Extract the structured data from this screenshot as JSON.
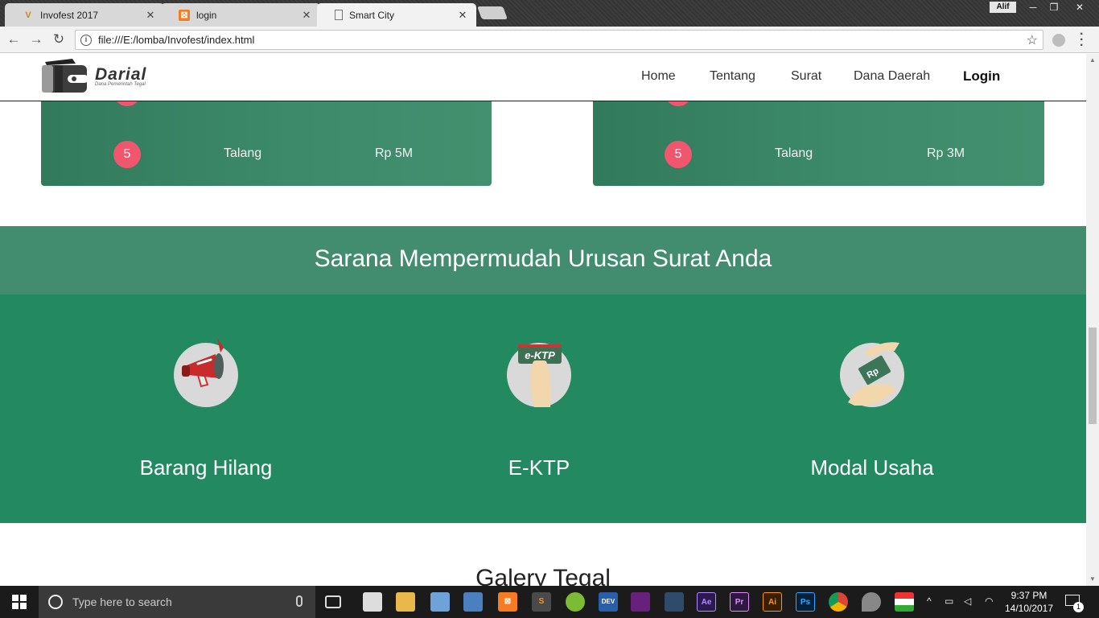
{
  "browser": {
    "tabs": [
      {
        "title": "Invofest 2017",
        "favicon": "v-logo-icon"
      },
      {
        "title": "login",
        "favicon": "xampp-icon"
      },
      {
        "title": "Smart City",
        "favicon": "page-icon"
      }
    ],
    "user": "Alif",
    "url": "file:///E:/lomba/Invofest/index.html"
  },
  "site": {
    "logo": {
      "brand": "Darial",
      "tagline": "Dana Pemerintah Tegal"
    },
    "nav": [
      {
        "label": "Home"
      },
      {
        "label": "Tentang"
      },
      {
        "label": "Surat"
      },
      {
        "label": "Dana Daerah"
      },
      {
        "label": "Login"
      }
    ],
    "cards": [
      {
        "rank": "5",
        "city": "Talang",
        "amount": "Rp 5M"
      },
      {
        "rank": "5",
        "city": "Talang",
        "amount": "Rp 3M"
      }
    ],
    "section": {
      "title": "Sarana Mempermudah Urusan Surat Anda",
      "services": [
        {
          "label": "Barang Hilang",
          "icon": "megaphone-icon"
        },
        {
          "label": "E-KTP",
          "icon": "ektp-card-icon",
          "icon_text": "e-KTP"
        },
        {
          "label": "Modal Usaha",
          "icon": "money-hand-icon",
          "icon_text": "Rp"
        }
      ]
    },
    "gallery_title": "Galery Tegal"
  },
  "taskbar": {
    "search_placeholder": "Type here to search",
    "apps": [
      "task-view",
      "store",
      "file-explorer",
      "3d-box",
      "virtualbox",
      "xampp",
      "sublime",
      "android-studio",
      "devcpp",
      "visual-studio",
      "media",
      "after-effects",
      "premiere",
      "illustrator",
      "photoshop",
      "chrome",
      "water-drop",
      "chrome-flag"
    ],
    "app_labels": {
      "devcpp": "DEV",
      "after-effects": "Ae",
      "premiere": "Pr",
      "illustrator": "Ai",
      "photoshop": "Ps"
    },
    "time": "9:37 PM",
    "date": "14/10/2017",
    "notification_count": "1"
  },
  "colors": {
    "section_head": "#428d6f",
    "section_body": "#238961",
    "badge": "#f0566e",
    "card": "#3c8a6a"
  }
}
